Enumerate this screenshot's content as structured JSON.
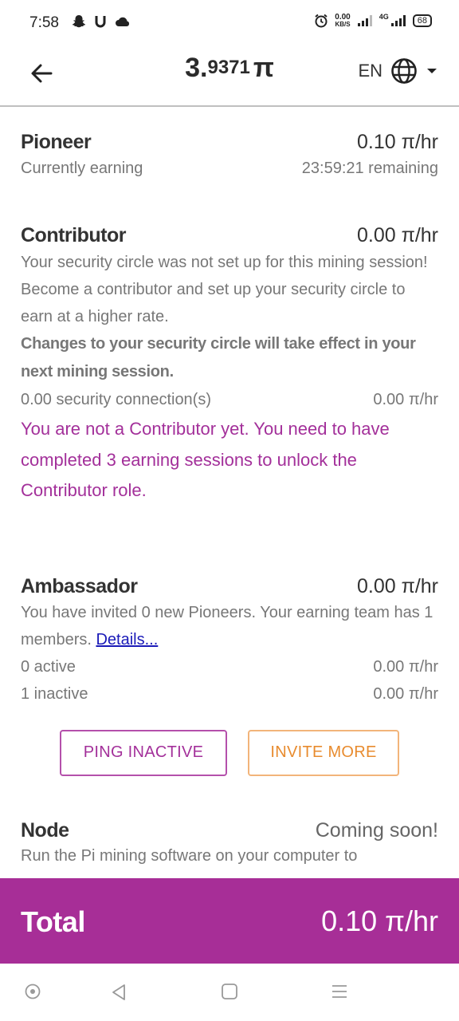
{
  "status_bar": {
    "time": "7:58",
    "net_speed_value": "0.00",
    "net_speed_unit": "KB/S",
    "network_label": "4G",
    "battery": "68"
  },
  "header": {
    "balance_int": "3.",
    "balance_dec": "9371",
    "balance_symbol": "π",
    "language": "EN"
  },
  "pioneer": {
    "title": "Pioneer",
    "rate": "0.10 π/hr",
    "status": "Currently earning",
    "remaining": "23:59:21 remaining"
  },
  "contributor": {
    "title": "Contributor",
    "rate": "0.00 π/hr",
    "description": "Your security circle was not set up for this mining session! Become a contributor and set up your security circle to earn at a higher rate.",
    "notice": "Changes to your security circle will take effect in your next mining session.",
    "connections_label": "0.00 security connection(s)",
    "connections_rate": "0.00 π/hr",
    "locked_message": "You are not a Contributor yet. You need to have completed 3 earning sessions to unlock the Contributor role."
  },
  "ambassador": {
    "title": "Ambassador",
    "rate": "0.00 π/hr",
    "description": "You have invited 0 new Pioneers. Your earning team has 1 members.",
    "details_link": "Details...",
    "active_label": "0 active",
    "active_rate": "0.00 π/hr",
    "inactive_label": "1 inactive",
    "inactive_rate": "0.00 π/hr",
    "ping_button": "PING INACTIVE",
    "invite_button": "INVITE MORE"
  },
  "node": {
    "title": "Node",
    "status": "Coming soon!",
    "description": "Run the Pi mining software on your computer to"
  },
  "total": {
    "label": "Total",
    "value": "0.10 π/hr"
  },
  "colors": {
    "accent": "#a72e97",
    "accent_text": "#a3309a",
    "invite": "#e88b2e"
  }
}
